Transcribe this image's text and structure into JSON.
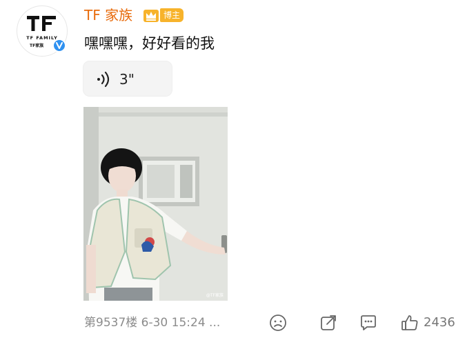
{
  "user": {
    "name": "TF 家族",
    "badge": "博主",
    "avatar_logo_text": "TF FAMILY",
    "avatar_logo_cn": "TF家族"
  },
  "post": {
    "text": "嘿嘿嘿，好好看的我",
    "voice": {
      "duration": "3\""
    },
    "image_watermark": "@TF家族"
  },
  "footer": {
    "floor_info": "第9537楼 6-30 15:24 ...",
    "like_count": "2436",
    "icons": [
      "emoji-face-icon",
      "share-icon",
      "comment-icon",
      "like-thumb-icon"
    ]
  },
  "colors": {
    "username": "#e86b0c",
    "badge_bg": "#f7b32b",
    "verify_blue": "#2f91f0",
    "meta_gray": "#8c8c8c"
  }
}
